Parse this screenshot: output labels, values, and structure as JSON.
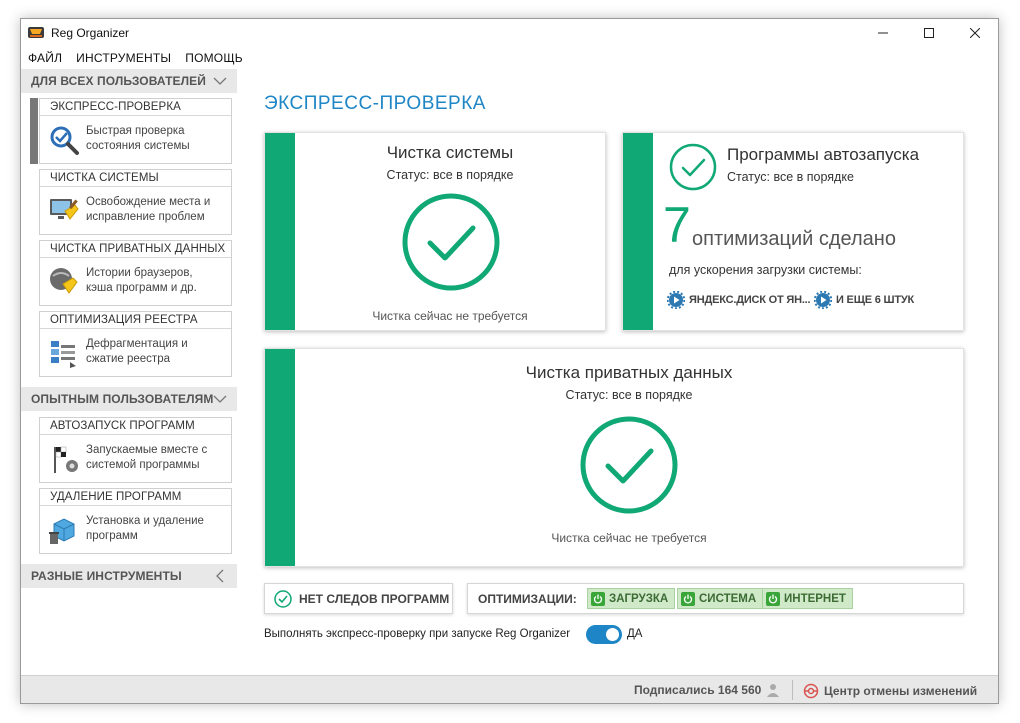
{
  "window": {
    "title": "Reg Organizer"
  },
  "menu": [
    "ФАЙЛ",
    "ИНСТРУМЕНТЫ",
    "ПОМОЩЬ"
  ],
  "sidebar": {
    "groups": [
      {
        "label": "ДЛЯ ВСЕХ ПОЛЬЗОВАТЕЛЕЙ"
      },
      {
        "label": "ОПЫТНЫМ ПОЛЬЗОВАТЕЛЯМ"
      },
      {
        "label": "РАЗНЫЕ ИНСТРУМЕНТЫ"
      }
    ],
    "items": [
      {
        "title": "ЭКСПРЕСС-ПРОВЕРКА",
        "desc1": "Быстрая проверка",
        "desc2": "состояния системы",
        "icon": "magnifier-check-icon"
      },
      {
        "title": "ЧИСТКА СИСТЕМЫ",
        "desc1": "Освобождение места и",
        "desc2": "исправление проблем",
        "icon": "broom-monitor-icon"
      },
      {
        "title": "ЧИСТКА ПРИВАТНЫХ ДАННЫХ",
        "desc1": "Истории браузеров,",
        "desc2": "кэша программ и др.",
        "icon": "browser-clean-icon"
      },
      {
        "title": "ОПТИМИЗАЦИЯ РЕЕСТРА",
        "desc1": "Дефрагментация и",
        "desc2": "сжатие реестра",
        "icon": "registry-defrag-icon"
      },
      {
        "title": "АВТОЗАПУСК ПРОГРАММ",
        "desc1": "Запускаемые вместе с",
        "desc2": "системой программы",
        "icon": "startup-flag-icon"
      },
      {
        "title": "УДАЛЕНИЕ ПРОГРАММ",
        "desc1": "Установка и удаление",
        "desc2": "программ",
        "icon": "uninstall-box-icon"
      }
    ]
  },
  "main": {
    "page_title": "ЭКСПРЕСС-ПРОВЕРКА",
    "system_clean": {
      "title": "Чистка системы",
      "status": "Статус: все в порядке",
      "note": "Чистка сейчас не требуется"
    },
    "autorun": {
      "title": "Программы автозапуска",
      "status": "Статус: все в порядке",
      "count": "7",
      "count_label": "оптимизаций сделано",
      "sub": "для ускорения загрузки системы:",
      "link1": "ЯНДЕКС.ДИСК ОТ ЯН...",
      "link2": "И ЕЩЕ 6 ШТУК"
    },
    "private_clean": {
      "title": "Чистка приватных данных",
      "status": "Статус: все в порядке",
      "note": "Чистка сейчас не требуется"
    },
    "traces": "НЕТ СЛЕДОВ ПРОГРАММ",
    "optimizations": {
      "label": "ОПТИМИЗАЦИИ:",
      "buttons": [
        "ЗАГРУЗКА",
        "СИСТЕМА",
        "ИНТЕРНЕТ"
      ]
    },
    "run_on_start": {
      "label": "Выполнять экспресс-проверку при запуске Reg Organizer",
      "value": "ДА",
      "enabled": true
    }
  },
  "statusbar": {
    "subscribers": "Подписались 164 560",
    "undo_center": "Центр отмены изменений"
  },
  "colors": {
    "accent_green": "#10a874",
    "title_blue": "#1e86c6"
  }
}
